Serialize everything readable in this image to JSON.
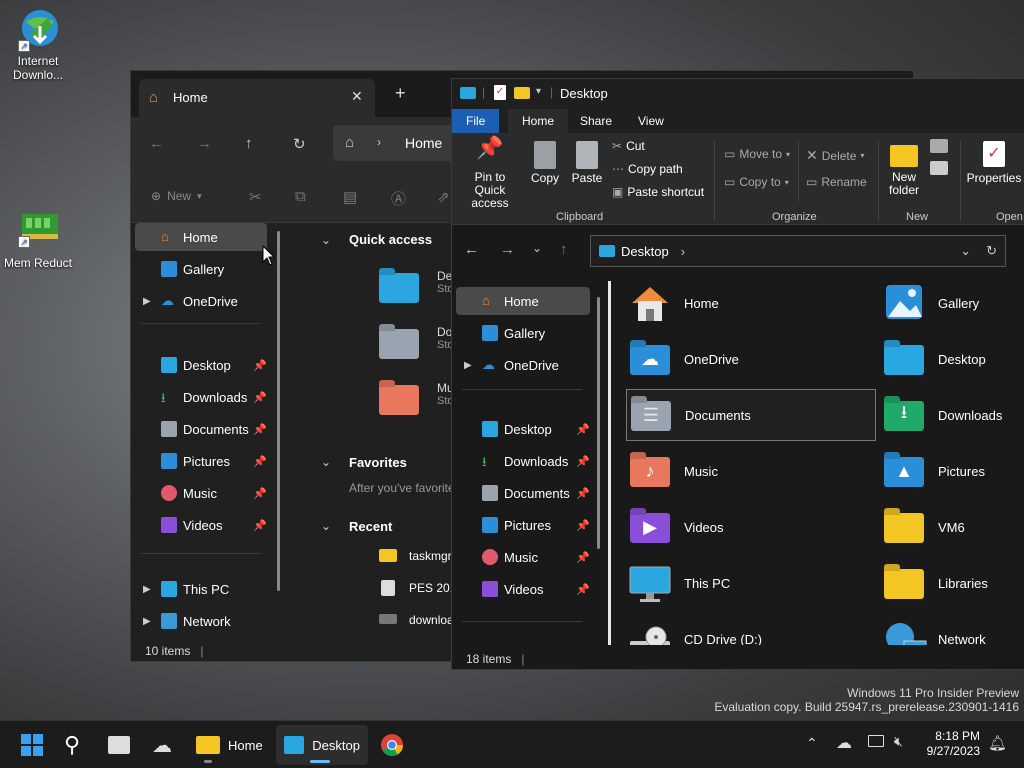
{
  "desktop": {
    "icons": [
      {
        "label": "Internet Downlo...",
        "icon": "globe-download-icon"
      },
      {
        "label": "Mem Reduct",
        "icon": "ram-chip-icon"
      }
    ],
    "watermark": {
      "line1": "Windows 11 Pro Insider Preview",
      "line2": "Evaluation copy. Build 25947.rs_prerelease.230901-1416"
    }
  },
  "window_back": {
    "tab_title": "Home",
    "close_glyph": "✕",
    "new_tab_glyph": "+",
    "address_crumb": "Home",
    "cmd": {
      "new_label": "New"
    },
    "nav": {
      "home": "Home",
      "gallery": "Gallery",
      "onedrive": "OneDrive",
      "desktop": "Desktop",
      "downloads": "Downloads",
      "documents": "Documents",
      "pictures": "Pictures",
      "music": "Music",
      "videos": "Videos",
      "thispc": "This PC",
      "network": "Network"
    },
    "content": {
      "quick_access": "Quick access",
      "qa_items": [
        {
          "line1": "De",
          "line2": "Sto"
        },
        {
          "line1": "Do",
          "line2": "Sto"
        },
        {
          "line1": "Mu",
          "line2": "Sto"
        }
      ],
      "favorites": "Favorites",
      "favorites_empty": "After you've favorite",
      "recent": "Recent",
      "recent_items": [
        "taskmgr",
        "PES 201",
        "downloa"
      ]
    },
    "status": "10 items"
  },
  "window_front": {
    "title": "Desktop",
    "ribbon_tabs": {
      "file": "File",
      "home": "Home",
      "share": "Share",
      "view": "View"
    },
    "ribbon": {
      "pin": "Pin to Quick access",
      "copy": "Copy",
      "paste": "Paste",
      "cut": "Cut",
      "copy_path": "Copy path",
      "paste_shortcut": "Paste shortcut",
      "clipboard": "Clipboard",
      "move_to": "Move to",
      "copy_to": "Copy to",
      "delete": "Delete",
      "rename": "Rename",
      "organize": "Organize",
      "new_folder": "New folder",
      "new": "New",
      "properties": "Properties",
      "open": "Open"
    },
    "address": "Desktop",
    "nav": {
      "home": "Home",
      "gallery": "Gallery",
      "onedrive": "OneDrive",
      "desktop": "Desktop",
      "downloads": "Downloads",
      "documents": "Documents",
      "pictures": "Pictures",
      "music": "Music",
      "videos": "Videos"
    },
    "items": [
      {
        "label": "Home",
        "icon": "home-icon"
      },
      {
        "label": "Gallery",
        "icon": "gallery-icon"
      },
      {
        "label": "OneDrive",
        "icon": "onedrive-folder-icon"
      },
      {
        "label": "Desktop",
        "icon": "desktop-folder-icon"
      },
      {
        "label": "Documents",
        "icon": "documents-folder-icon"
      },
      {
        "label": "Downloads",
        "icon": "downloads-folder-icon"
      },
      {
        "label": "Music",
        "icon": "music-folder-icon"
      },
      {
        "label": "Pictures",
        "icon": "pictures-folder-icon"
      },
      {
        "label": "Videos",
        "icon": "videos-folder-icon"
      },
      {
        "label": "VM6",
        "icon": "folder-icon"
      },
      {
        "label": "This PC",
        "icon": "monitor-icon"
      },
      {
        "label": "Libraries",
        "icon": "libraries-folder-icon"
      },
      {
        "label": "CD Drive (D:)",
        "icon": "cd-drive-icon"
      },
      {
        "label": "Network",
        "icon": "network-icon"
      }
    ],
    "status": "18 items"
  },
  "taskbar": {
    "apps": [
      {
        "label": "Home",
        "icon": "file-explorer-icon"
      },
      {
        "label": "Desktop",
        "icon": "file-explorer-desktop-icon"
      }
    ],
    "time": "8:18 PM",
    "date": "9/27/2023"
  },
  "colors": {
    "accent": "#1a5fb4",
    "folder_yellow": "#f3c623",
    "folder_blue": "#2a8fd8"
  }
}
